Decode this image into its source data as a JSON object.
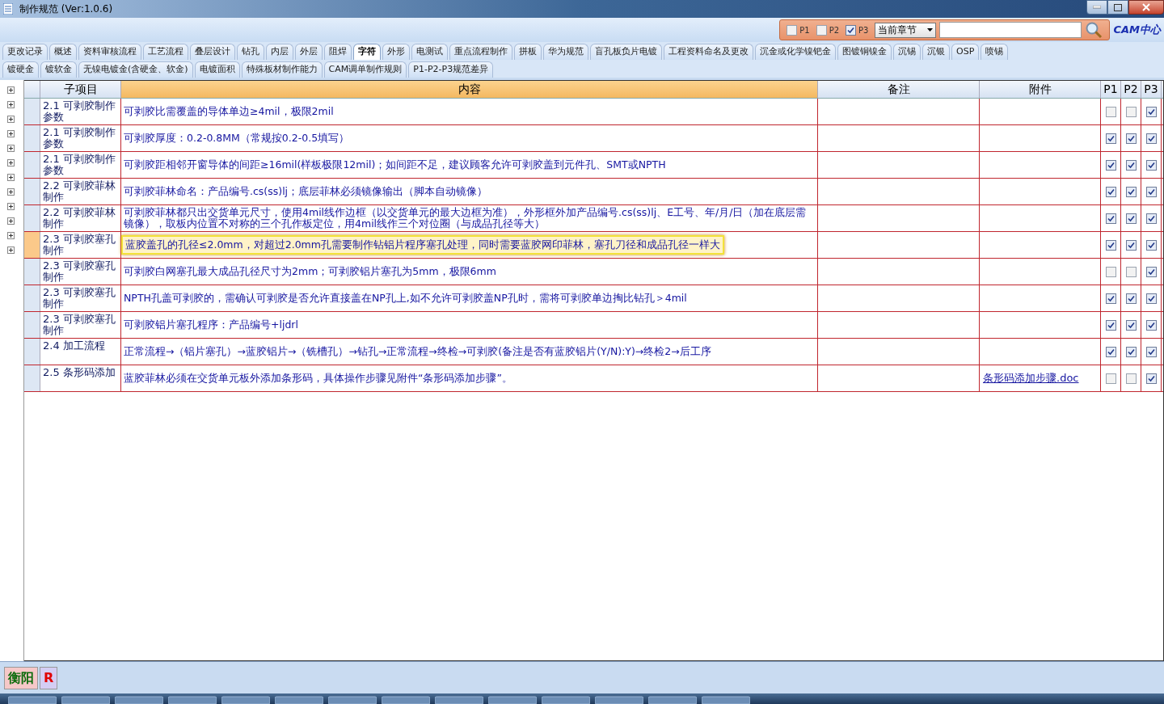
{
  "window": {
    "title": "制作规范 (Ver:1.0.6)"
  },
  "filter": {
    "options": [
      {
        "label": "P1",
        "checked": false
      },
      {
        "label": "P2",
        "checked": false
      },
      {
        "label": "P3",
        "checked": true
      }
    ],
    "scope": "当前章节",
    "logo": "CAM中心"
  },
  "tabs": [
    [
      {
        "label": "更改记录",
        "selected": false
      },
      {
        "label": "概述",
        "selected": false
      },
      {
        "label": "资料审核流程",
        "selected": false
      },
      {
        "label": "工艺流程",
        "selected": false
      },
      {
        "label": "叠层设计",
        "selected": false
      },
      {
        "label": "钻孔",
        "selected": false
      },
      {
        "label": "内层",
        "selected": false
      },
      {
        "label": "外层",
        "selected": false
      },
      {
        "label": "阻焊",
        "selected": false
      },
      {
        "label": "字符",
        "selected": true
      },
      {
        "label": "外形",
        "selected": false
      },
      {
        "label": "电测试",
        "selected": false
      },
      {
        "label": "重点流程制作",
        "selected": false
      },
      {
        "label": "拼板",
        "selected": false
      },
      {
        "label": "华为规范",
        "selected": false
      },
      {
        "label": "盲孔板负片电镀",
        "selected": false
      },
      {
        "label": "工程资料命名及更改",
        "selected": false
      },
      {
        "label": "沉金或化学镍钯金",
        "selected": false
      },
      {
        "label": "图镀铜镍金",
        "selected": false
      },
      {
        "label": "沉锡",
        "selected": false
      },
      {
        "label": "沉银",
        "selected": false
      },
      {
        "label": "OSP",
        "selected": false
      },
      {
        "label": "喷锡",
        "selected": false
      }
    ],
    [
      {
        "label": "镀硬金",
        "selected": false
      },
      {
        "label": "镀软金",
        "selected": false
      },
      {
        "label": "无镍电镀金(含硬金、软金)",
        "selected": false
      },
      {
        "label": "电镀面积",
        "selected": false
      },
      {
        "label": "特殊板材制作能力",
        "selected": false
      },
      {
        "label": "CAM调单制作规则",
        "selected": false
      },
      {
        "label": "P1-P2-P3规范差异",
        "selected": false
      }
    ]
  ],
  "table": {
    "columns": [
      "子项目",
      "内容",
      "备注",
      "附件",
      "P1",
      "P2",
      "P3"
    ],
    "rows": [
      {
        "sub": "2.1 可剥胶制作参数",
        "content": "可剥胶比需覆盖的导体单边≥4mil，极限2mil",
        "p1": false,
        "p2": false,
        "p3": true,
        "selected": false
      },
      {
        "sub": "2.1 可剥胶制作参数",
        "content": "可剥胶厚度：0.2-0.8MM（常规按0.2-0.5填写）",
        "p1": true,
        "p2": true,
        "p3": true,
        "selected": false
      },
      {
        "sub": "2.1 可剥胶制作参数",
        "content": "可剥胶距相邻开窗导体的间距≥16mil(样板极限12mil)；如间距不足，建议顾客允许可剥胶盖到元件孔、SMT或NPTH",
        "p1": true,
        "p2": true,
        "p3": true,
        "selected": false
      },
      {
        "sub": "2.2 可剥胶菲林制作",
        "content": "可剥胶菲林命名：产品编号.cs(ss)lj；底层菲林必须镜像输出（脚本自动镜像）",
        "p1": true,
        "p2": true,
        "p3": true,
        "selected": false
      },
      {
        "sub": "2.2 可剥胶菲林制作",
        "content": "可剥胶菲林都只出交货单元尺寸，使用4mil线作边框（以交货单元的最大边框为准），外形框外加产品编号.cs(ss)lj、E工号、年/月/日（加在底层需镜像），取板内位置不对称的三个孔作板定位，用4mil线作三个对位圈（与成品孔径等大）",
        "p1": true,
        "p2": true,
        "p3": true,
        "selected": false
      },
      {
        "sub": "2.3 可剥胶塞孔制作",
        "content": "蓝胶盖孔的孔径≤2.0mm，对超过2.0mm孔需要制作钻铝片程序塞孔处理，同时需要蓝胶网印菲林，塞孔刀径和成品孔径一样大",
        "p1": true,
        "p2": true,
        "p3": true,
        "selected": true
      },
      {
        "sub": "2.3 可剥胶塞孔制作",
        "content": "可剥胶白网塞孔最大成品孔径尺寸为2mm；可剥胶铝片塞孔为5mm，极限6mm",
        "p1": false,
        "p2": false,
        "p3": true,
        "selected": false
      },
      {
        "sub": "2.3 可剥胶塞孔制作",
        "content": "NPTH孔盖可剥胶的，需确认可剥胶是否允许直接盖在NP孔上,如不允许可剥胶盖NP孔时，需将可剥胶单边掏比钻孔＞4mil",
        "p1": true,
        "p2": true,
        "p3": true,
        "selected": false
      },
      {
        "sub": "2.3 可剥胶塞孔制作",
        "content": "可剥胶铝片塞孔程序：产品编号+ljdrl",
        "p1": true,
        "p2": true,
        "p3": true,
        "selected": false
      },
      {
        "sub": "2.4 加工流程",
        "content": "正常流程→（铝片塞孔）→蓝胶铝片→（铣槽孔）→钻孔→正常流程→终检→可剥胶(备注是否有蓝胶铝片(Y/N):Y)→终检2→后工序",
        "p1": true,
        "p2": true,
        "p3": true,
        "selected": false
      },
      {
        "sub": "2.5 条形码添加",
        "content": "蓝胶菲林必须在交货单元板外添加条形码，具体操作步骤见附件“条形码添加步骤”。",
        "attachment": "条形码添加步骤.doc",
        "p1": false,
        "p2": false,
        "p3": true,
        "selected": false
      }
    ]
  },
  "status": {
    "site": "衡阳",
    "mark": "R"
  }
}
